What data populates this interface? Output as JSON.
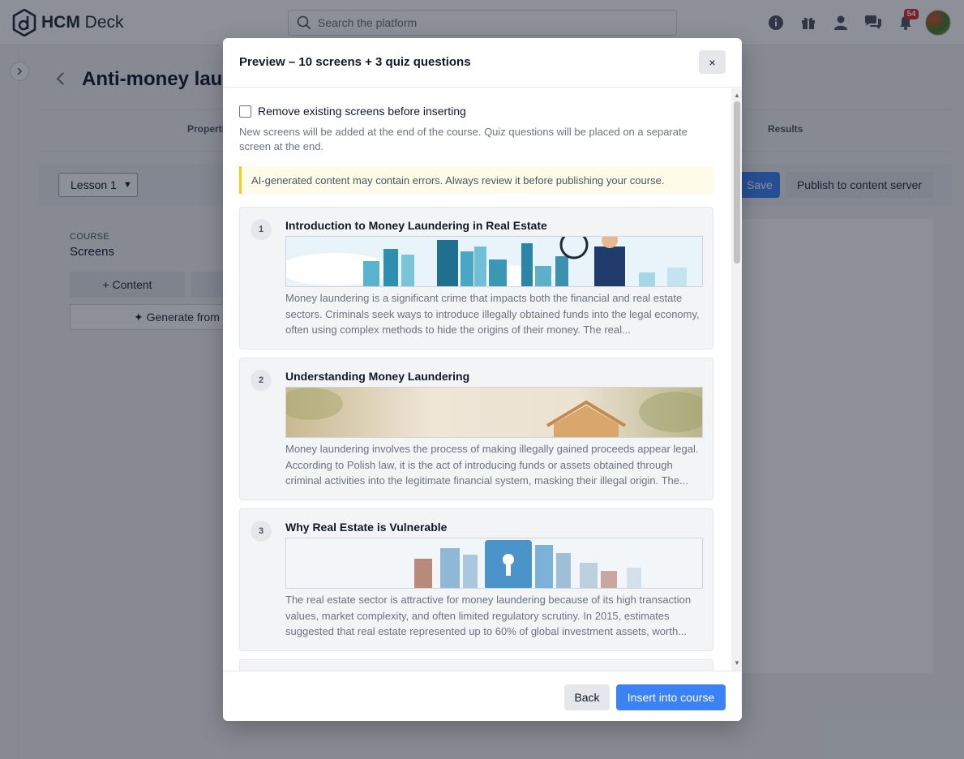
{
  "app": {
    "logo_text_bold": "HCM",
    "logo_text": " Deck"
  },
  "search": {
    "placeholder": "Search the platform"
  },
  "header": {
    "notification_count": "54"
  },
  "page": {
    "title": "Anti-money laundering",
    "tabs": [
      "Properties",
      "Results"
    ],
    "lesson_select": "Lesson 1",
    "save_label": "Save",
    "publish_label": "Publish to content server",
    "course_label": "COURSE",
    "course_subtitle": "Screens",
    "content_button": "+ Content",
    "generate_button": "✦ Generate from PDF"
  },
  "modal": {
    "title": "Preview – 10 screens + 3 quiz questions",
    "close_label": "×",
    "checkbox_label": "Remove existing screens before inserting",
    "hint": "New screens will be added at the end of the course. Quiz questions will be placed on a separate screen at the end.",
    "warning": "AI-generated content may contain errors. Always review it before publishing your course.",
    "screens": [
      {
        "number": "1",
        "title": "Introduction to Money Laundering in Real Estate",
        "text": "Money laundering is a significant crime that impacts both the financial and real estate sectors. Criminals seek ways to introduce illegally obtained funds into the legal economy, often using complex methods to hide the origins of their money. The real..."
      },
      {
        "number": "2",
        "title": "Understanding Money Laundering",
        "text": "Money laundering involves the process of making illegally gained proceeds appear legal. According to Polish law, it is the act of introducing funds or assets obtained through criminal activities into the legitimate financial system, masking their illegal origin. The..."
      },
      {
        "number": "3",
        "title": "Why Real Estate is Vulnerable",
        "text": "The real estate sector is attractive for money laundering because of its high transaction values, market complexity, and often limited regulatory scrutiny. In 2015, estimates suggested that real estate represented up to 60% of global investment assets, worth..."
      }
    ],
    "back_label": "Back",
    "insert_label": "Insert into course"
  }
}
